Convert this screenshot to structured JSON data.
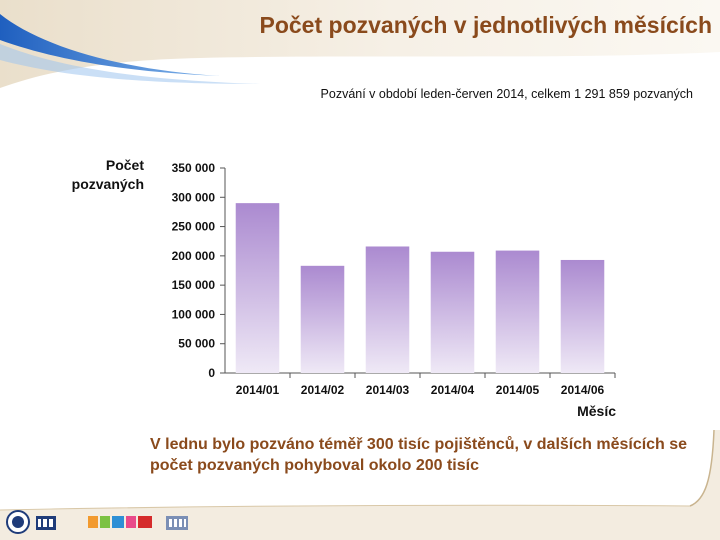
{
  "slide": {
    "title": "Počet pozvaných v jednotlivých měsících",
    "note": "V lednu bylo pozváno téměř 300 tisíc pojištěnců, v dalších měsících se počet pozvaných pohyboval okolo 200 tisíc",
    "logos": [
      "MU",
      "IBA",
      "ÚZIS"
    ],
    "colors": {
      "title": "#8a4a1c",
      "bar_top": "#ab8ad0",
      "bar_bottom": "#efe9f6",
      "header_swoosh": "#1f5fbf"
    }
  },
  "chart_data": {
    "type": "bar",
    "title": "Pozvání v období leden-červen 2014, celkem 1 291 859 pozvaných",
    "ylabel": "Počet pozvaných",
    "xlabel": "Měsíc",
    "categories": [
      "2014/01",
      "2014/02",
      "2014/03",
      "2014/04",
      "2014/05",
      "2014/06"
    ],
    "values": [
      290000,
      183000,
      216000,
      207000,
      209000,
      193000
    ],
    "ylim": [
      0,
      350000
    ],
    "yticks": [
      0,
      50000,
      100000,
      150000,
      200000,
      250000,
      300000,
      350000
    ],
    "ytick_labels": [
      "0",
      "50 000",
      "100 000",
      "150 000",
      "200 000",
      "250 000",
      "300 000",
      "350 000"
    ],
    "grid": false,
    "legend": "none"
  }
}
